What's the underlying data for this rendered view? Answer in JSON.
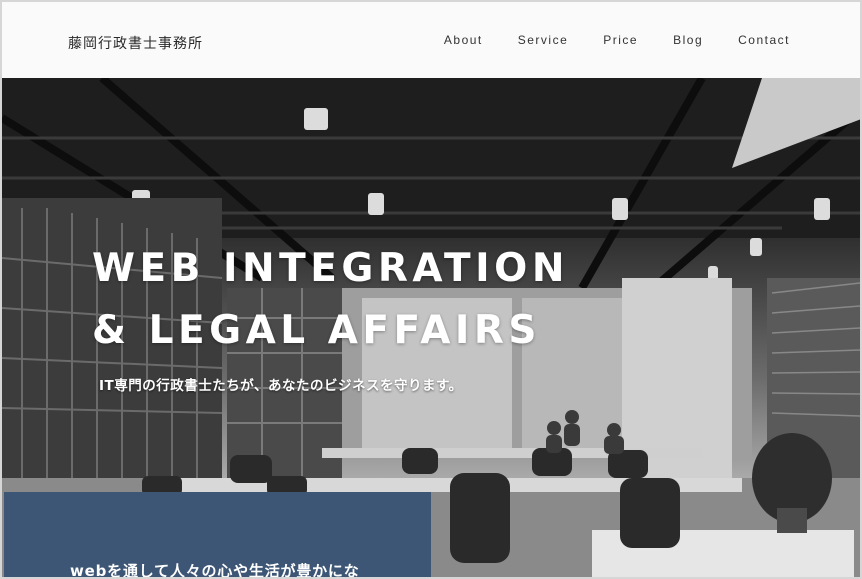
{
  "header": {
    "logo": "藤岡行政書士事務所",
    "nav": [
      {
        "label": "About"
      },
      {
        "label": "Service"
      },
      {
        "label": "Price"
      },
      {
        "label": "Blog"
      },
      {
        "label": "Contact"
      }
    ]
  },
  "hero": {
    "title_line1": "WEB INTEGRATION",
    "title_line2": "& LEGAL AFFAIRS",
    "subtitle": "IT専門の行政書士たちが、あなたのビジネスを守ります。",
    "background": "grayscale office interior photo"
  },
  "intro": {
    "text": "webを通して人々の心や生活が豊かにな",
    "box_color": "#3e5676"
  }
}
